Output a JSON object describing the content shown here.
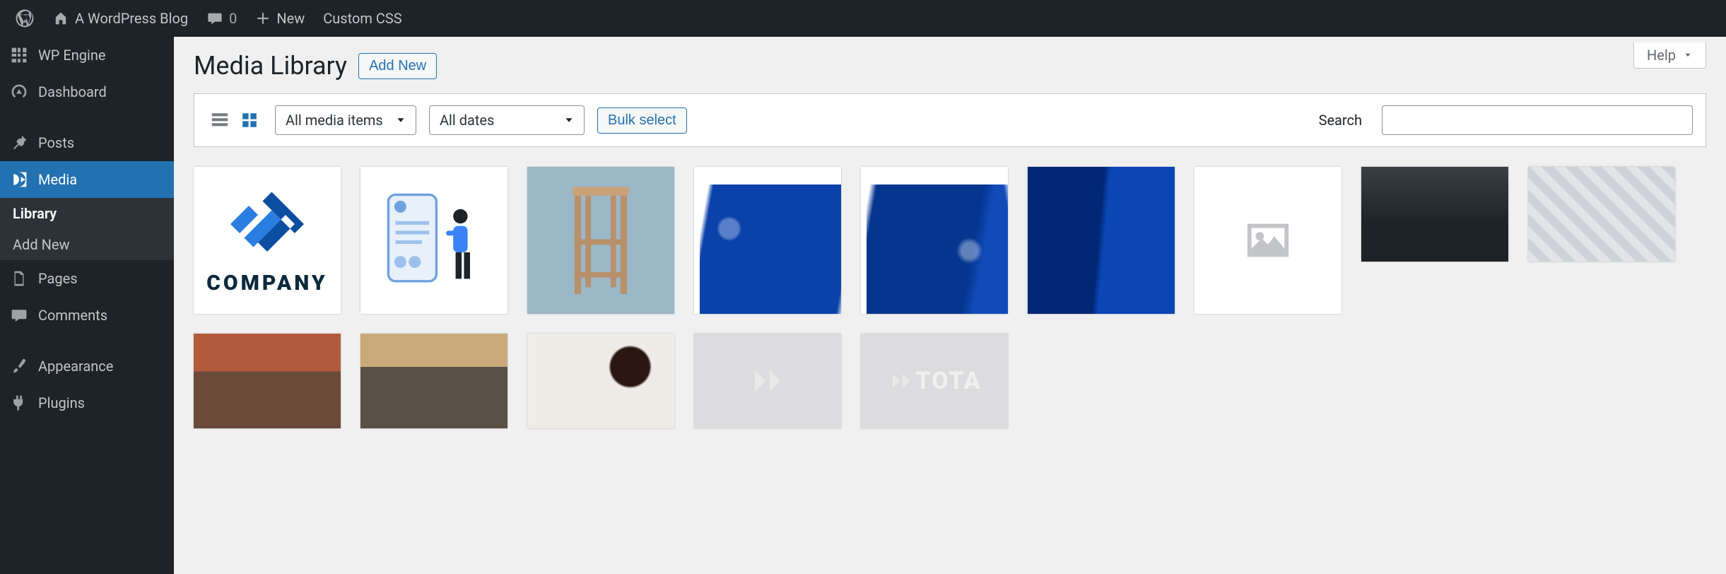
{
  "adminbar": {
    "site_name": "A WordPress Blog",
    "comments_count": "0",
    "new_label": "New",
    "custom_css_label": "Custom CSS"
  },
  "sidebar": {
    "items": [
      {
        "id": "wpengine",
        "label": "WP Engine",
        "icon": "wpengine-icon"
      },
      {
        "id": "dashboard",
        "label": "Dashboard",
        "icon": "dashboard-icon"
      },
      {
        "id": "posts",
        "label": "Posts",
        "icon": "pin-icon"
      },
      {
        "id": "media",
        "label": "Media",
        "icon": "media-icon",
        "current": true
      },
      {
        "id": "pages",
        "label": "Pages",
        "icon": "page-icon"
      },
      {
        "id": "comments",
        "label": "Comments",
        "icon": "comment-icon"
      },
      {
        "id": "appearance",
        "label": "Appearance",
        "icon": "brush-icon"
      },
      {
        "id": "plugins",
        "label": "Plugins",
        "icon": "plug-icon"
      }
    ],
    "sub_items": [
      {
        "id": "library",
        "label": "Library",
        "current": true
      },
      {
        "id": "addnew",
        "label": "Add New"
      }
    ]
  },
  "page": {
    "title": "Media Library",
    "add_new_label": "Add New",
    "help_label": "Help"
  },
  "toolbar": {
    "view_list_label": "List view",
    "view_grid_label": "Grid view",
    "filter_type_value": "All media items",
    "filter_date_value": "All dates",
    "bulk_select_label": "Bulk select",
    "search_label": "Search",
    "search_value": ""
  },
  "media_items_row1": [
    {
      "id": "company-logo",
      "kind": "company"
    },
    {
      "id": "illustration-user-document",
      "kind": "illus"
    },
    {
      "id": "stool-photo",
      "kind": "stool"
    },
    {
      "id": "blue-paint-1",
      "kind": "paint1"
    },
    {
      "id": "blue-paint-2",
      "kind": "paint2"
    },
    {
      "id": "blue-paint-3",
      "kind": "paint3"
    },
    {
      "id": "image-placeholder",
      "kind": "placeholder"
    }
  ],
  "media_items_row2": [
    {
      "id": "photo-person-reclining",
      "kind": "photo"
    },
    {
      "id": "photo-blueprints",
      "kind": "photo"
    },
    {
      "id": "photo-team-pointing",
      "kind": "photo"
    },
    {
      "id": "photo-coworking-laptops",
      "kind": "photo"
    },
    {
      "id": "photo-coffee-hands",
      "kind": "photo"
    },
    {
      "id": "gray-placeholder-1",
      "kind": "gray"
    },
    {
      "id": "gray-placeholder-total",
      "kind": "gray-total"
    }
  ],
  "strings": {
    "company_word": "COMPANY",
    "total_word": "TOTA"
  }
}
